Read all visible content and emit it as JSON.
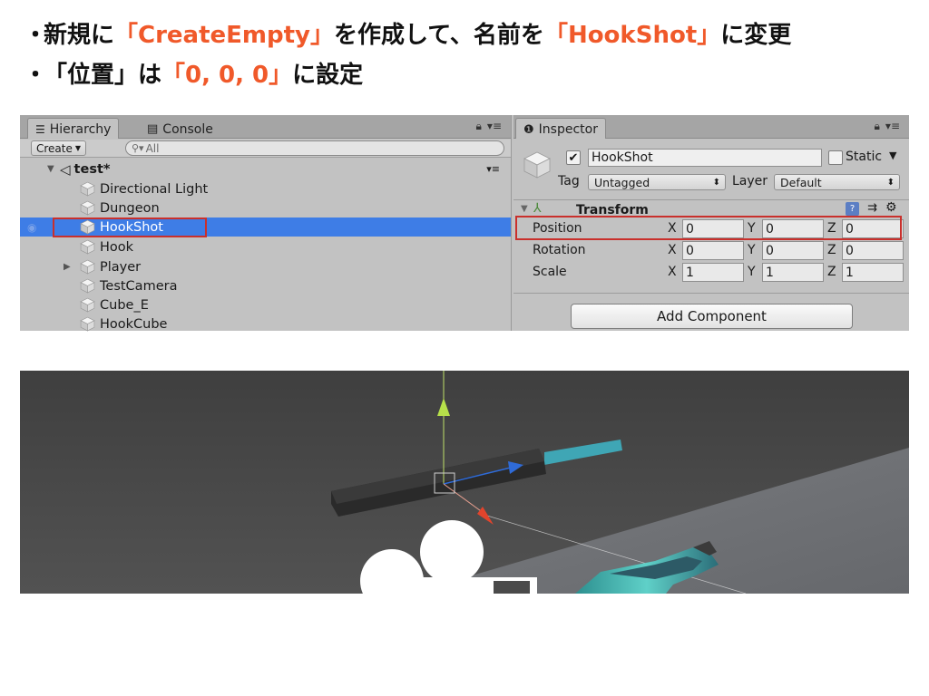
{
  "slide": {
    "bullet1": {
      "dot": "・",
      "t1": "新規に",
      "h1": "「CreateEmpty」",
      "t2": "を作成して、名前を",
      "h2": "「HookShot」",
      "t3": "に変更"
    },
    "bullet2": {
      "dot": "・",
      "t1": "「位置」は",
      "h1": "「0, 0, 0」",
      "t2": "に設定"
    }
  },
  "hierarchy": {
    "tab_label": "Hierarchy",
    "console_tab_label": "Console",
    "create_label": "Create",
    "search_placeholder": "All",
    "scene_name": "test*",
    "items": [
      {
        "label": "Directional Light"
      },
      {
        "label": "Dungeon"
      },
      {
        "label": "HookShot",
        "selected": true
      },
      {
        "label": "Hook"
      },
      {
        "label": "Player",
        "has_children": true
      },
      {
        "label": "TestCamera"
      },
      {
        "label": "Cube_E"
      },
      {
        "label": "HookCube"
      }
    ]
  },
  "inspector": {
    "tab_label": "Inspector",
    "active": true,
    "object_name": "HookShot",
    "static_label": "Static",
    "static_checked": false,
    "tag_label": "Tag",
    "tag_value": "Untagged",
    "layer_label": "Layer",
    "layer_value": "Default",
    "transform": {
      "title": "Transform",
      "position_label": "Position",
      "rotation_label": "Rotation",
      "scale_label": "Scale",
      "axis_x": "X",
      "axis_y": "Y",
      "axis_z": "Z",
      "position": {
        "x": "0",
        "y": "0",
        "z": "0"
      },
      "rotation": {
        "x": "0",
        "y": "0",
        "z": "0"
      },
      "scale": {
        "x": "1",
        "y": "1",
        "z": "1"
      }
    },
    "add_component_label": "Add Component"
  },
  "colors": {
    "highlight": "#f0592a",
    "selection": "#3e7de6",
    "annotation_box": "#c9302c",
    "gizmo_y": "#b6e04a",
    "gizmo_z": "#2f6bd8",
    "gizmo_x": "#e2442c"
  }
}
